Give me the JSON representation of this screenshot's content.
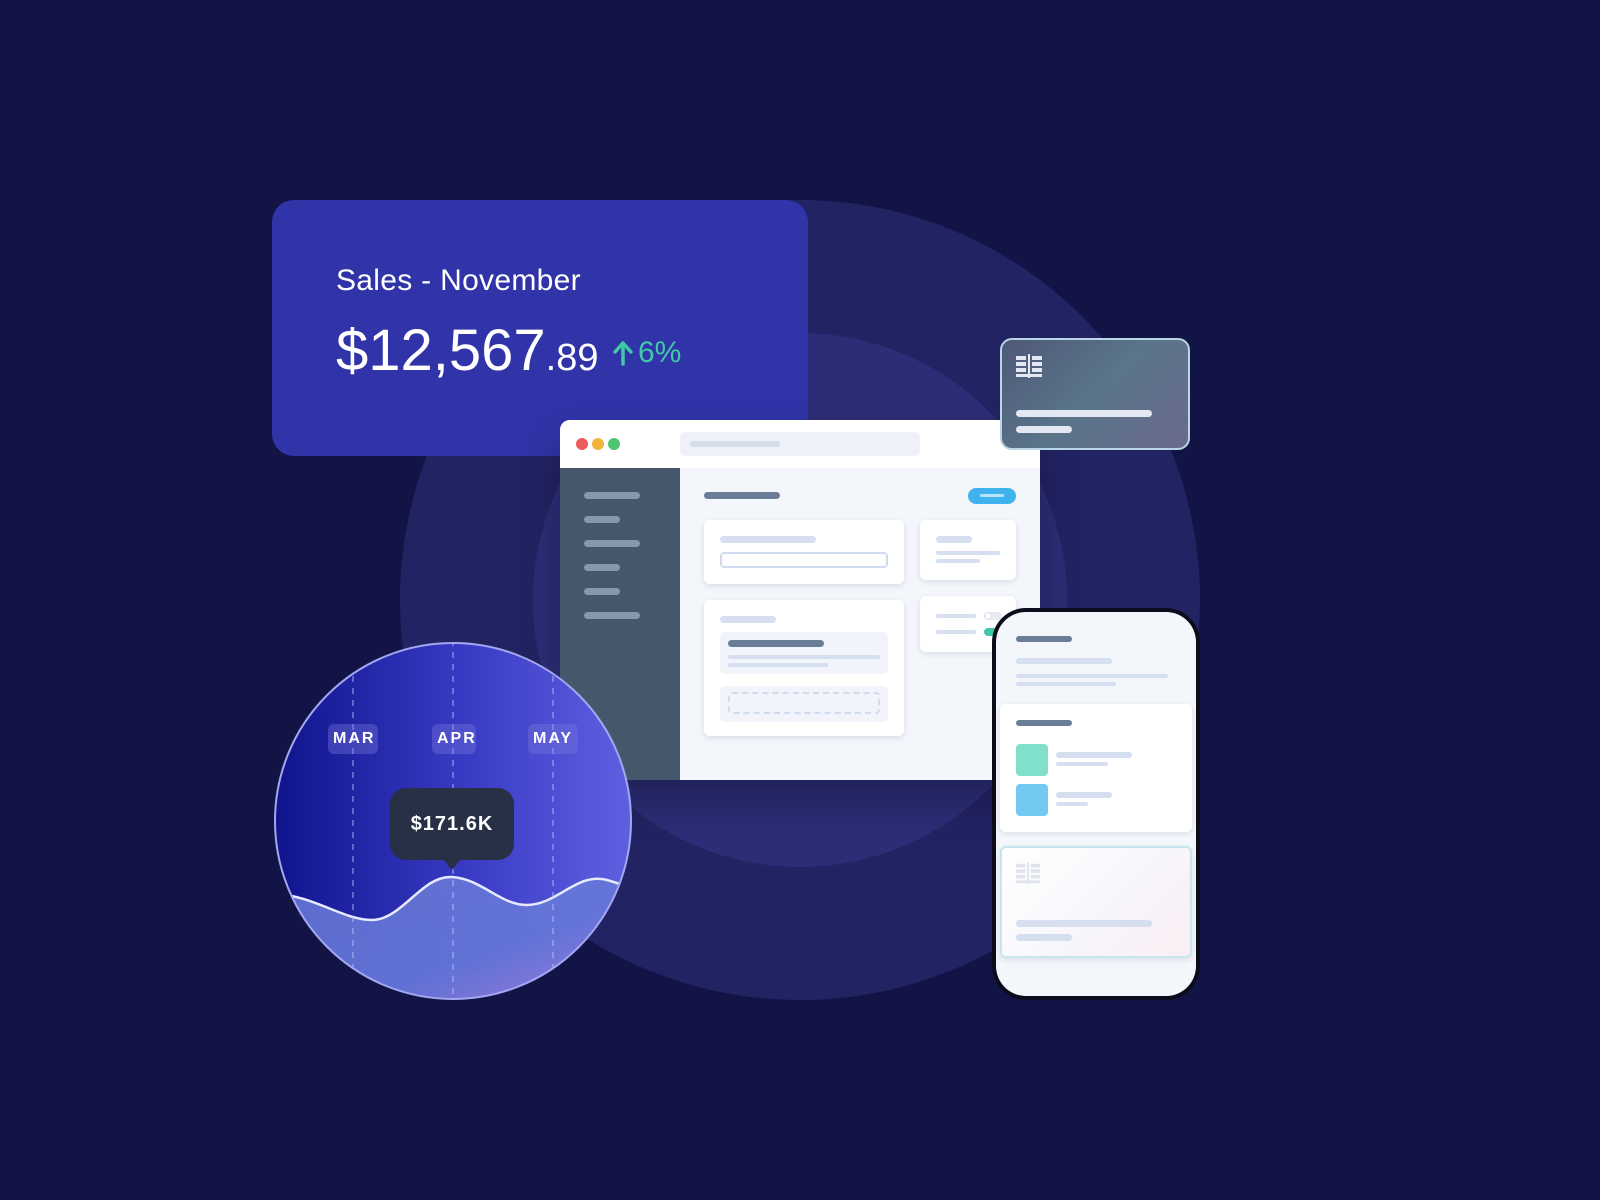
{
  "sales_card": {
    "title": "Sales - November",
    "amount_main": "$12,567",
    "amount_cents": ".89",
    "change": "6%",
    "change_icon": "arrow-up-icon",
    "change_color": "#3fc9a6",
    "card_color": "#3134a8"
  },
  "browser": {
    "traffic_lights": [
      "#ee5b5b",
      "#f2b33d",
      "#4fc36d"
    ],
    "sidebar_color": "#46566b",
    "accent_button_color": "#3eb3ee"
  },
  "credit_card": {
    "icon": "chip-icon"
  },
  "phone": {
    "tile_colors": [
      "#80e0cc",
      "#71c8f0"
    ],
    "card_icon": "chip-icon"
  },
  "chart_data": {
    "type": "area",
    "categories": [
      "MAR",
      "APR",
      "MAY"
    ],
    "tooltip_value": "$171.6K",
    "highlighted_category": "APR"
  },
  "background_color": "#131446"
}
